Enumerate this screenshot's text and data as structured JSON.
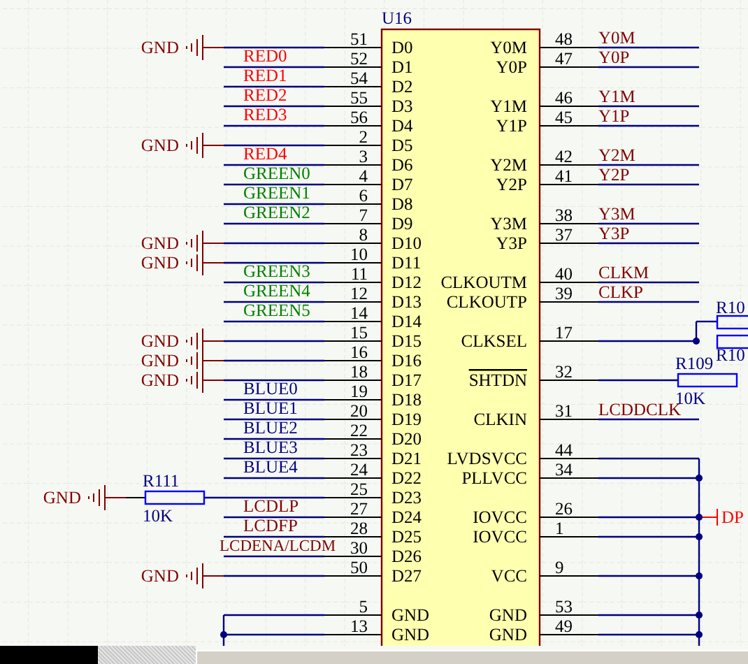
{
  "schematic": {
    "designator": "U16",
    "left_pins": [
      {
        "name": "D0",
        "number": "51",
        "kind": "gnd",
        "ground": "GND"
      },
      {
        "name": "D1",
        "number": "52",
        "kind": "net",
        "net": "RED0",
        "color": "#ff0000"
      },
      {
        "name": "D2",
        "number": "54",
        "kind": "net",
        "net": "RED1",
        "color": "#ff0000"
      },
      {
        "name": "D3",
        "number": "55",
        "kind": "net",
        "net": "RED2",
        "color": "#ff0000"
      },
      {
        "name": "D4",
        "number": "56",
        "kind": "net",
        "net": "RED3",
        "color": "#ff0000"
      },
      {
        "name": "D5",
        "number": "2",
        "kind": "gnd",
        "ground": "GND"
      },
      {
        "name": "D6",
        "number": "3",
        "kind": "net",
        "net": "RED4",
        "color": "#ff0000"
      },
      {
        "name": "D7",
        "number": "4",
        "kind": "net",
        "net": "GREEN0",
        "color": "#008000"
      },
      {
        "name": "D8",
        "number": "6",
        "kind": "net",
        "net": "GREEN1",
        "color": "#008000"
      },
      {
        "name": "D9",
        "number": "7",
        "kind": "net",
        "net": "GREEN2",
        "color": "#008000"
      },
      {
        "name": "D10",
        "number": "8",
        "kind": "gnd",
        "ground": "GND"
      },
      {
        "name": "D11",
        "number": "10",
        "kind": "gnd",
        "ground": "GND"
      },
      {
        "name": "D12",
        "number": "11",
        "kind": "net",
        "net": "GREEN3",
        "color": "#008000"
      },
      {
        "name": "D13",
        "number": "12",
        "kind": "net",
        "net": "GREEN4",
        "color": "#008000"
      },
      {
        "name": "D14",
        "number": "14",
        "kind": "net",
        "net": "GREEN5",
        "color": "#008000"
      },
      {
        "name": "D15",
        "number": "15",
        "kind": "gnd",
        "ground": "GND"
      },
      {
        "name": "D16",
        "number": "16",
        "kind": "gnd",
        "ground": "GND"
      },
      {
        "name": "D17",
        "number": "18",
        "kind": "gnd",
        "ground": "GND"
      },
      {
        "name": "D18",
        "number": "19",
        "kind": "net",
        "net": "BLUE0",
        "color": "#000080"
      },
      {
        "name": "D19",
        "number": "20",
        "kind": "net",
        "net": "BLUE1",
        "color": "#000080"
      },
      {
        "name": "D20",
        "number": "22",
        "kind": "net",
        "net": "BLUE2",
        "color": "#000080"
      },
      {
        "name": "D21",
        "number": "23",
        "kind": "net",
        "net": "BLUE3",
        "color": "#000080"
      },
      {
        "name": "D22",
        "number": "24",
        "kind": "net",
        "net": "BLUE4",
        "color": "#000080"
      },
      {
        "name": "D23",
        "number": "25",
        "kind": "resistor",
        "designator": "R111",
        "value": "10K",
        "ground": "GND"
      },
      {
        "name": "D24",
        "number": "27",
        "kind": "net",
        "net": "LCDLP",
        "color": "#800000"
      },
      {
        "name": "D25",
        "number": "28",
        "kind": "net",
        "net": "LCDFP",
        "color": "#800000"
      },
      {
        "name": "D26",
        "number": "30",
        "kind": "net",
        "net": "LCDENA/LCDM",
        "color": "#800000"
      },
      {
        "name": "D27",
        "number": "50",
        "kind": "gnd",
        "ground": "GND"
      },
      {
        "kind": "spacer"
      },
      {
        "name": "GND",
        "number": "5",
        "kind": "bus"
      },
      {
        "name": "GND",
        "number": "13",
        "kind": "bus"
      }
    ],
    "right_pins": [
      {
        "name": "Y0M",
        "number": "48",
        "kind": "net",
        "net": "Y0M"
      },
      {
        "name": "Y0P",
        "number": "47",
        "kind": "net",
        "net": "Y0P"
      },
      {
        "kind": "spacer"
      },
      {
        "name": "Y1M",
        "number": "46",
        "kind": "net",
        "net": "Y1M"
      },
      {
        "name": "Y1P",
        "number": "45",
        "kind": "net",
        "net": "Y1P"
      },
      {
        "kind": "spacer"
      },
      {
        "name": "Y2M",
        "number": "42",
        "kind": "net",
        "net": "Y2M"
      },
      {
        "name": "Y2P",
        "number": "41",
        "kind": "net",
        "net": "Y2P"
      },
      {
        "kind": "spacer"
      },
      {
        "name": "Y3M",
        "number": "38",
        "kind": "net",
        "net": "Y3M"
      },
      {
        "name": "Y3P",
        "number": "37",
        "kind": "net",
        "net": "Y3P"
      },
      {
        "kind": "spacer"
      },
      {
        "name": "CLKOUTM",
        "number": "40",
        "kind": "net",
        "net": "CLKM"
      },
      {
        "name": "CLKOUTP",
        "number": "39",
        "kind": "net",
        "net": "CLKP"
      },
      {
        "kind": "spacer"
      },
      {
        "name": "CLKSEL",
        "number": "17",
        "kind": "resistor_pair",
        "designators": [
          "R10",
          "R10"
        ]
      },
      {
        "kind": "spacer"
      },
      {
        "name": "SHTDN",
        "overline": true,
        "number": "32",
        "kind": "resistor",
        "designator": "R109",
        "value": "10K"
      },
      {
        "kind": "spacer"
      },
      {
        "name": "CLKIN",
        "number": "31",
        "kind": "net",
        "net": "LCDDCLK"
      },
      {
        "kind": "spacer"
      },
      {
        "name": "LVDSVCC",
        "number": "44",
        "kind": "bus"
      },
      {
        "name": "PLLVCC",
        "number": "34",
        "kind": "bus"
      },
      {
        "kind": "spacer"
      },
      {
        "name": "IOVCC",
        "number": "26",
        "kind": "bus",
        "probe": "DP"
      },
      {
        "name": "IOVCC",
        "number": "1",
        "kind": "bus"
      },
      {
        "kind": "spacer"
      },
      {
        "name": "VCC",
        "number": "9",
        "kind": "bus"
      },
      {
        "kind": "spacer"
      },
      {
        "name": "GND",
        "number": "53",
        "kind": "bus"
      },
      {
        "name": "GND",
        "number": "49",
        "kind": "bus"
      }
    ]
  }
}
